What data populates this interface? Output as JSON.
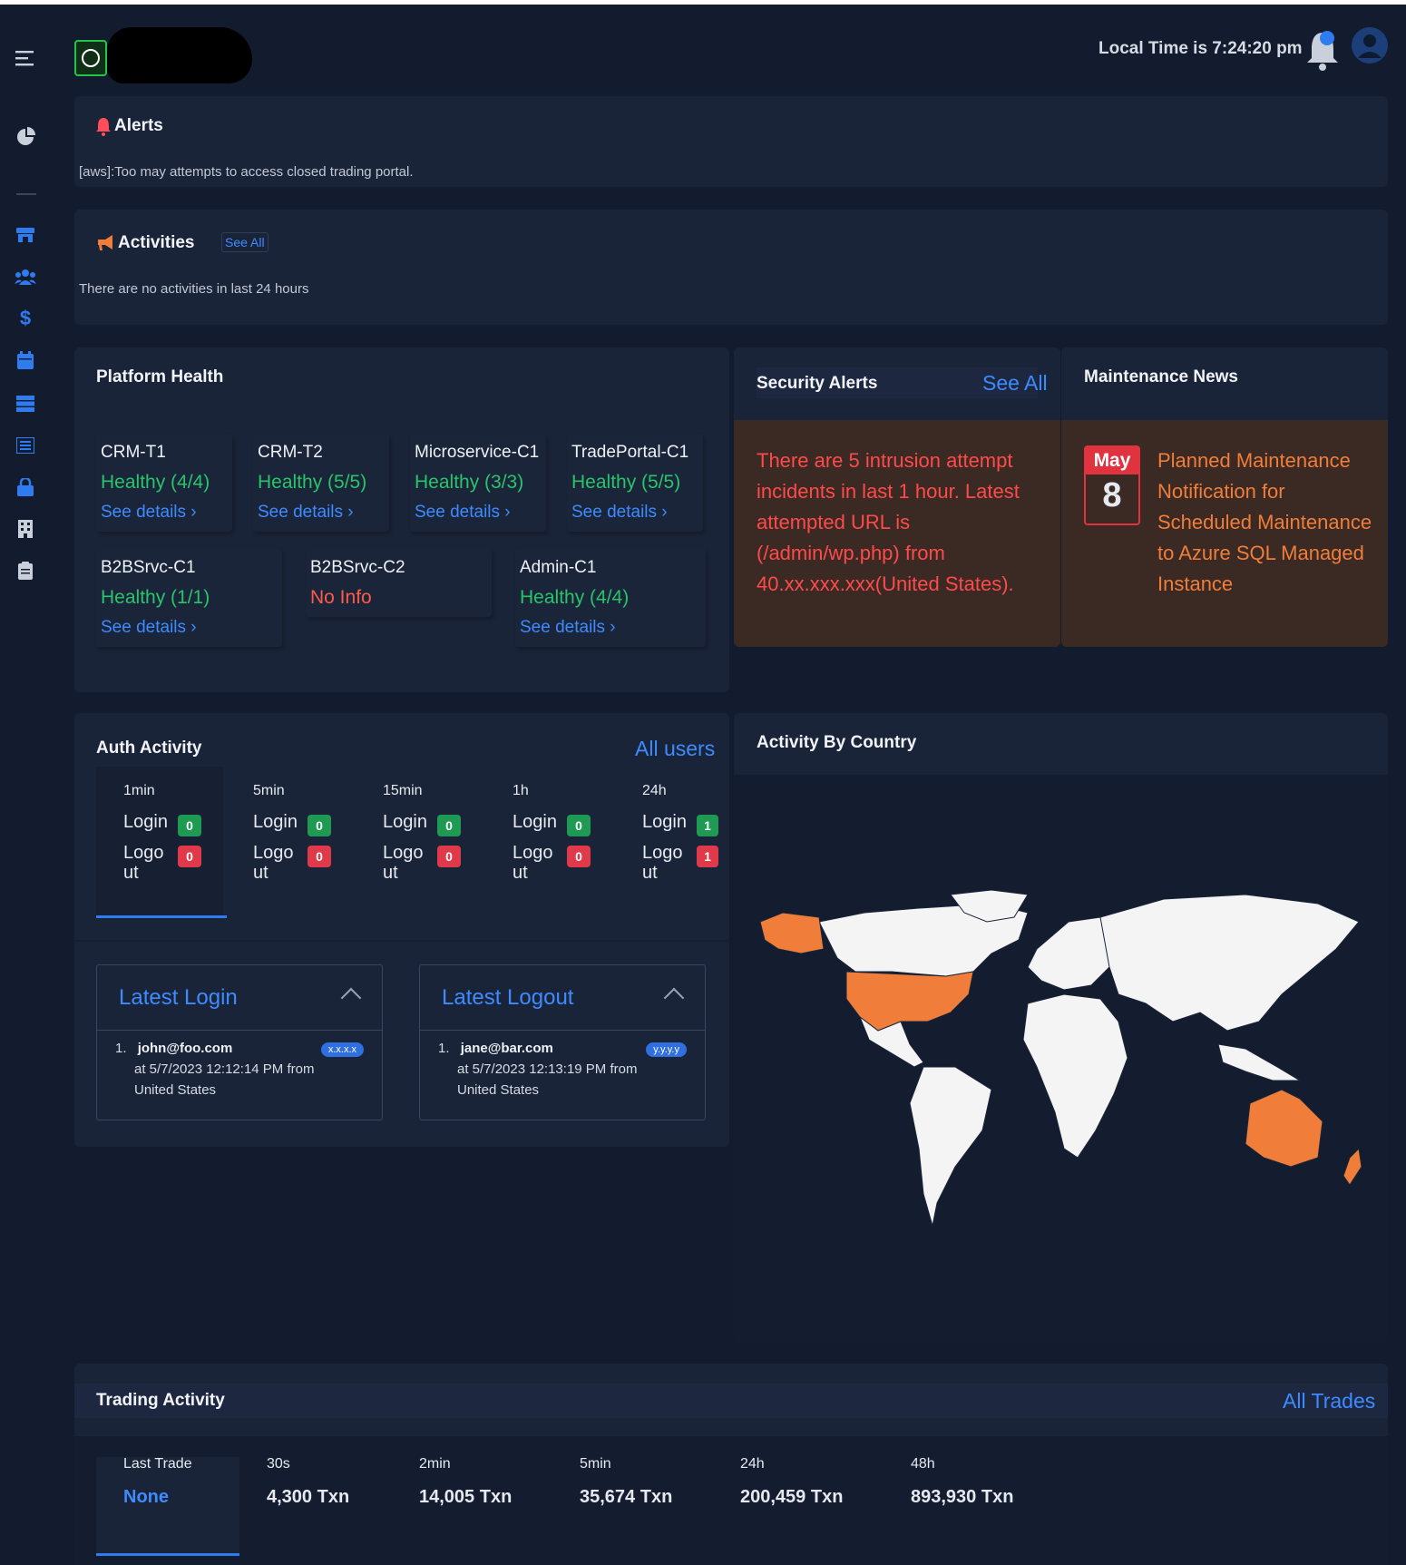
{
  "header": {
    "local_time": "Local Time is 7:24:20 pm"
  },
  "icons": {
    "menu": "menu-icon",
    "dashboard": "pie-chart-icon",
    "notifications": "bell-icon",
    "user": "user-avatar-icon"
  },
  "alerts": {
    "title": "Alerts",
    "message": "[aws]:Too may attempts to access closed trading portal."
  },
  "activities": {
    "title": "Activities",
    "see_all": "See All",
    "message": "There are no activities in last 24 hours"
  },
  "platform_health": {
    "title": "Platform Health",
    "services": [
      {
        "name": "CRM-T1",
        "status": "Healthy (4/4)",
        "details": "See details ›"
      },
      {
        "name": "CRM-T2",
        "status": "Healthy (5/5)",
        "details": "See details ›"
      },
      {
        "name": "Microservice-C1",
        "status": "Healthy (3/3)",
        "details": "See details ›"
      },
      {
        "name": "TradePortal-C1",
        "status": "Healthy (5/5)",
        "details": "See details ›"
      },
      {
        "name": "B2BSrvc-C1",
        "status": "Healthy (1/1)",
        "details": "See details ›"
      },
      {
        "name": "B2BSrvc-C2",
        "status": "No Info",
        "details": ""
      },
      {
        "name": "Admin-C1",
        "status": "Healthy (4/4)",
        "details": "See details ›"
      }
    ]
  },
  "security_alerts": {
    "title": "Security Alerts",
    "see_all": "See All",
    "message": "There are 5 intrusion attempt incidents in last 1 hour. Latest attempted URL is (/admin/wp.php) from 40.xx.xxx.xxx(United States)."
  },
  "maintenance": {
    "title": "Maintenance News",
    "month": "May",
    "day": "8",
    "message": "Planned Maintenance Notification for Scheduled Maintenance to Azure SQL Managed Instance"
  },
  "auth_activity": {
    "title": "Auth Activity",
    "all_users": "All users",
    "login_label": "Login",
    "logout_label_1": "Logo",
    "logout_label_2": "ut",
    "periods": [
      {
        "label": "1min",
        "login": "0",
        "logout": "0"
      },
      {
        "label": "5min",
        "login": "0",
        "logout": "0"
      },
      {
        "label": "15min",
        "login": "0",
        "logout": "0"
      },
      {
        "label": "1h",
        "login": "0",
        "logout": "0"
      },
      {
        "label": "24h",
        "login": "1",
        "logout": "1"
      }
    ],
    "latest_login": {
      "title": "Latest Login",
      "index": "1.",
      "user": "john@foo.com",
      "time": "at 5/7/2023 12:12:14 PM from",
      "location": "United States",
      "ip": "x.x.x.x"
    },
    "latest_logout": {
      "title": "Latest Logout",
      "index": "1.",
      "user": "jane@bar.com",
      "time": "at 5/7/2023 12:13:19 PM from",
      "location": "United States",
      "ip": "y.y.y.y"
    }
  },
  "activity_by_country": {
    "title": "Activity By Country",
    "highlight_color": "#f07e3a",
    "land_color": "#f4f4f4"
  },
  "trading_activity": {
    "title": "Trading Activity",
    "all_trades": "All Trades",
    "periods": [
      {
        "label": "Last Trade",
        "value": "None"
      },
      {
        "label": "30s",
        "value": "4,300 Txn"
      },
      {
        "label": "2min",
        "value": "14,005 Txn"
      },
      {
        "label": "5min",
        "value": "35,674 Txn"
      },
      {
        "label": "24h",
        "value": "200,459 Txn"
      },
      {
        "label": "48h",
        "value": "893,930 Txn"
      }
    ]
  },
  "colors": {
    "background": "#131c2e",
    "card": "#1a2438",
    "accent": "#3d8bff",
    "healthy": "#29c46a",
    "danger": "#ff5a4a",
    "alert_card": "#3b2a24"
  }
}
